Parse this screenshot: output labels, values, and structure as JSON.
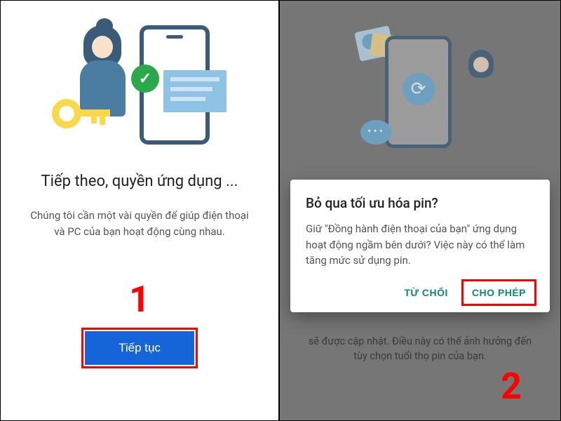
{
  "left": {
    "heading": "Tiếp theo, quyền ứng dụng ...",
    "description": "Chúng tôi cần một vài quyền để giúp điện thoại và PC của bạn hoạt động cùng nhau.",
    "step_number": "1",
    "continue_label": "Tiếp tục"
  },
  "right": {
    "dimmed_text": "sẽ được cập nhật. Điều này có thể ảnh hưởng đến tùy chọn tuổi thọ pin của bạn.",
    "step_number": "2",
    "dialog": {
      "title": "Bỏ qua tối ưu hóa pin?",
      "body": "Giữ \"Đồng hành điện thoại của bạn\" ứng dụng hoạt động ngầm bên dưới? Việc này có thể làm tăng mức sử dụng pin.",
      "deny_label": "TỪ CHỐI",
      "allow_label": "CHO PHÉP"
    }
  },
  "icons": {
    "check": "✓",
    "sync": "⟳"
  },
  "highlight_color": "#f00"
}
